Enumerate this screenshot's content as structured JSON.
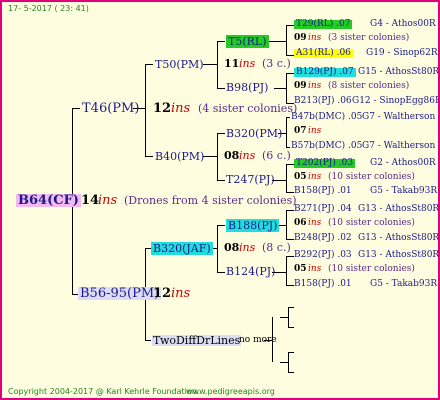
{
  "header": {
    "date": "17- 5-2017 ( 23: 41)"
  },
  "footer": {
    "copyright": "Copyright 2004-2017 @ Karl Kehrle Foundation.",
    "site": "www.pedigreeapis.org"
  },
  "root": {
    "label": "B64(CF)",
    "ins_num": "14",
    "ins": "ins",
    "note": "(Drones from 4 sister colonies)"
  },
  "gen1": [
    {
      "label": "T46(PM)",
      "ins_num": "12",
      "ins": "ins",
      "note": "(4 sister colonies)"
    },
    {
      "label": "B56-95(PM)",
      "ins_num": "12",
      "ins": "ins"
    }
  ],
  "gen2": [
    {
      "label": "T50(PM)",
      "ins_num": "11",
      "ins": "ins",
      "note": "(3 c.)"
    },
    {
      "label": "B40(PM)",
      "ins_num": "08",
      "ins": "ins",
      "note": "(6 c.)"
    },
    {
      "label": "B320(JAF)",
      "ins_num": "08",
      "ins": "ins",
      "note": "(8 c.)"
    },
    {
      "label": "TwoDiffDrLines",
      "note": "no more"
    }
  ],
  "gen3": [
    {
      "label": "T5(RL)"
    },
    {
      "label": "B98(PJ)"
    },
    {
      "label": "B320(PM)",
      "ins_num": "07",
      "ins": "ins"
    },
    {
      "label": "T247(PJ)"
    },
    {
      "label": "B188(PJ)"
    },
    {
      "label": "B124(PJ)"
    }
  ],
  "gen4": [
    {
      "label": "T29(RL) .07",
      "code": "G4 - Athos00R"
    },
    {
      "num": "09",
      "ins": "ins",
      "note": "(3 sister colonies)"
    },
    {
      "label": "A31(RL) .06",
      "code": "G19 - Sinop62R"
    },
    {
      "label": "B129(PJ) .07",
      "code": "G15 - AthosSt80R"
    },
    {
      "num": "09",
      "ins": "ins",
      "note": "(8 sister colonies)"
    },
    {
      "label": "B213(PJ) .06",
      "code": "G12 - SinopEgg86R"
    },
    {
      "label": "B47b(DMC) .05",
      "code": "G7 - Waltherson"
    },
    {
      "label": "B57b(DMC) .05",
      "code": "G7 - Waltherson"
    },
    {
      "label": "T202(PJ) .03",
      "code": "G2 - Athos00R"
    },
    {
      "num": "05",
      "ins": "ins",
      "note": "(10 sister colonies)"
    },
    {
      "label": "B158(PJ) .01",
      "code": "G5 - Takab93R"
    },
    {
      "label": "B271(PJ) .04",
      "code": "G13 - AthosSt80R"
    },
    {
      "num": "06",
      "ins": "ins",
      "note": "(10 sister colonies)"
    },
    {
      "label": "B248(PJ) .02",
      "code": "G13 - AthosSt80R"
    },
    {
      "label": "B292(PJ) .03",
      "code": "G13 - AthosSt80R"
    },
    {
      "num": "05",
      "ins": "ins",
      "note": "(10 sister colonies)"
    },
    {
      "label": "B158(PJ) .01",
      "code": "G5 - Takab93R"
    }
  ]
}
